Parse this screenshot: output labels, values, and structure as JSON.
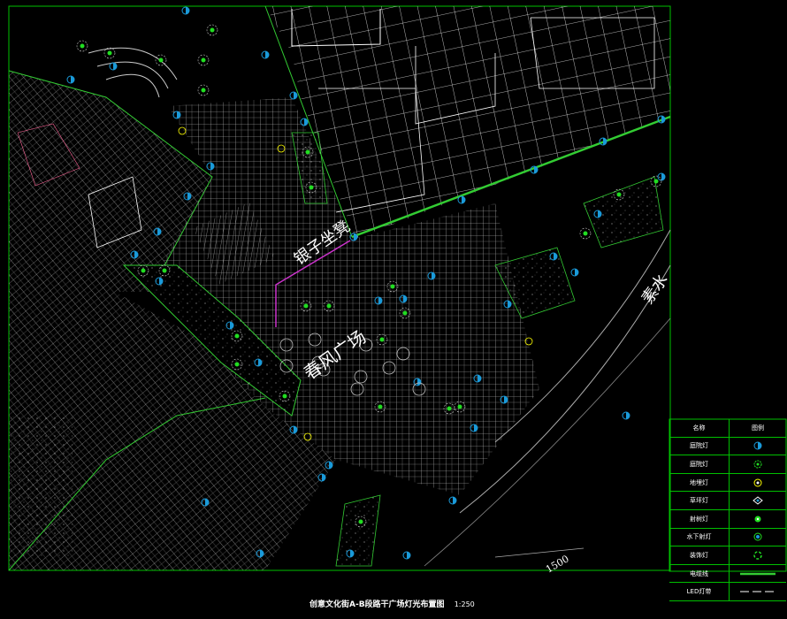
{
  "drawing": {
    "title": "创意文化街A-B段路干广场灯光布置图",
    "scale": "1:250",
    "plaza_label": "春风广场",
    "bench_label": "银子坐凳",
    "street_label": "素水",
    "dim_label": "1500",
    "colors": {
      "frame": "#00c000",
      "grid": "#e0e0e0",
      "paving": "#bdbdbd",
      "lamp": "#1a9ad9",
      "tree": "#22dd22",
      "accent": "#ffff00",
      "cable": "#cc33cc",
      "led": "#33cc33"
    }
  },
  "legend": {
    "header_name": "名称",
    "header_symbol": "图例",
    "items": [
      {
        "name": "庭院灯",
        "icon": "lamp-icon"
      },
      {
        "name": "庭院灯",
        "icon": "tree-light-icon"
      },
      {
        "name": "地埋灯",
        "icon": "buried-light-icon"
      },
      {
        "name": "草坪灯",
        "icon": "lawn-light-icon"
      },
      {
        "name": "射树灯",
        "icon": "tree-spot-icon"
      },
      {
        "name": "水下射灯",
        "icon": "underwater-light-icon"
      },
      {
        "name": "装饰灯",
        "icon": "decor-light-icon"
      },
      {
        "name": "电缆线",
        "icon": "cable-line-icon"
      },
      {
        "name": "LED灯带",
        "icon": "led-strip-icon"
      }
    ]
  }
}
